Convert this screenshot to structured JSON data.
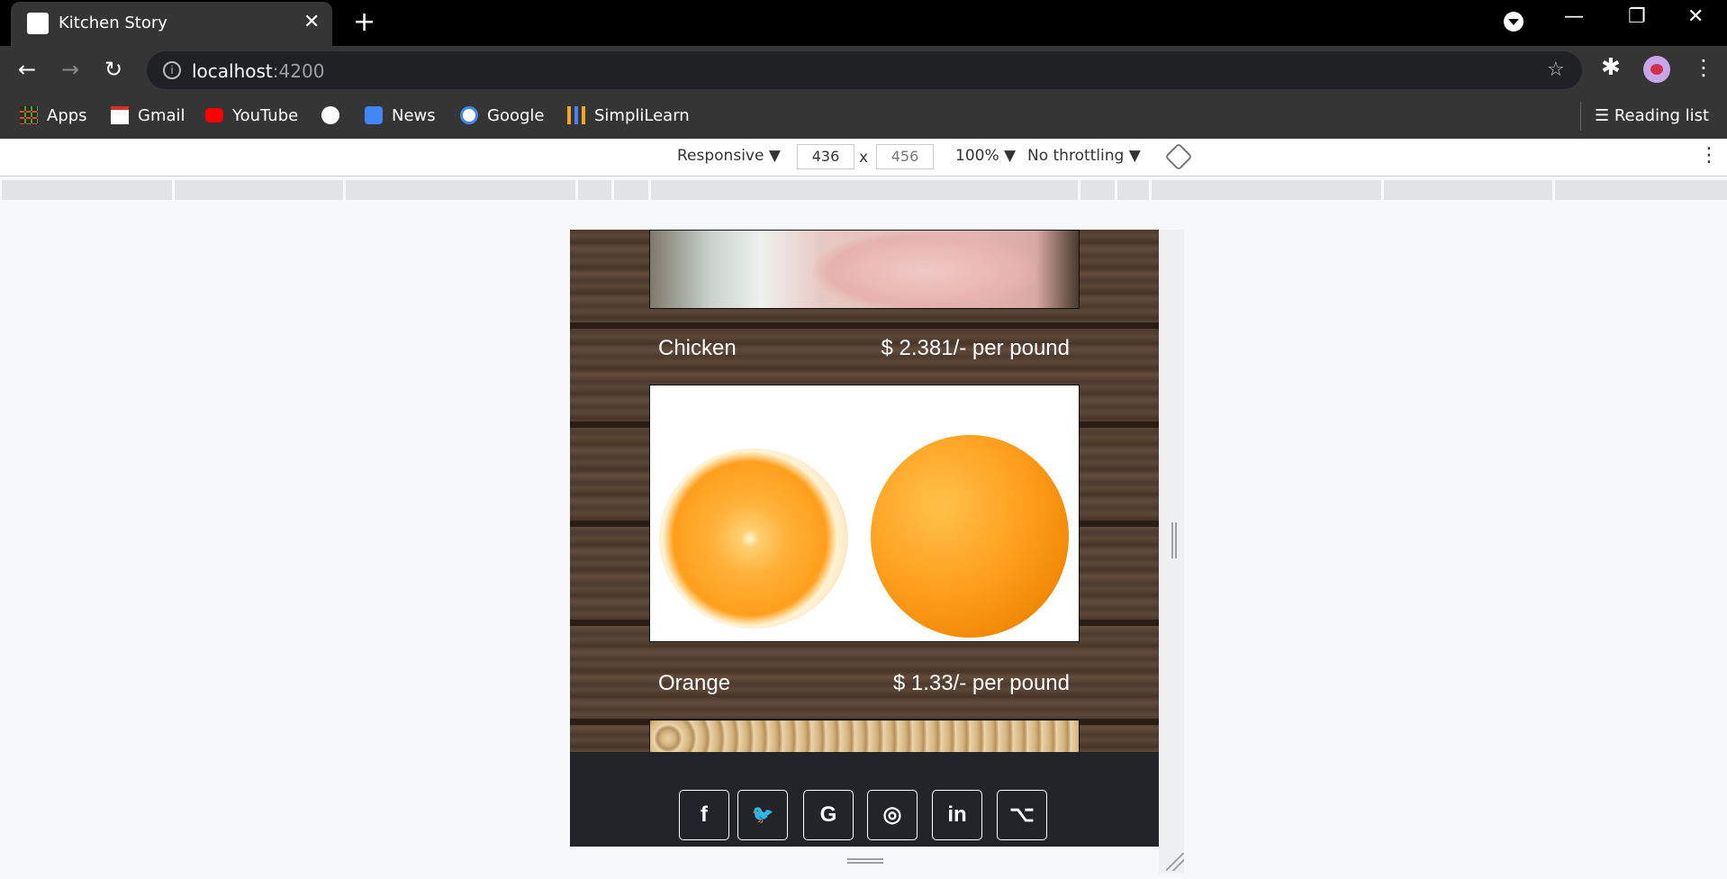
{
  "tab": {
    "title": "Kitchen Story",
    "close": "✕",
    "new_tab": "+"
  },
  "window": {
    "minimize": "—",
    "restore": "❐",
    "close": "✕"
  },
  "toolbar": {
    "back": "←",
    "forward": "→",
    "reload": "↻",
    "url_host": "localhost",
    "url_port": ":4200",
    "star": "☆",
    "menu": "⋮"
  },
  "bookmarks": [
    {
      "label": "Apps",
      "icon": "apps-grid-icon",
      "color": "#ea4335"
    },
    {
      "label": "Gmail",
      "icon": "gmail-icon",
      "color": "#d93025"
    },
    {
      "label": "YouTube",
      "icon": "youtube-icon",
      "color": "#ff0000"
    },
    {
      "label": "",
      "icon": "globe-icon",
      "color": "#ffffff"
    },
    {
      "label": "News",
      "icon": "news-icon",
      "color": "#4285f4"
    },
    {
      "label": "Google",
      "icon": "google-icon",
      "color": "#4285f4"
    },
    {
      "label": "SimpliLearn",
      "icon": "simplilearn-icon",
      "color": "#f5a623"
    }
  ],
  "reading_list": "Reading list",
  "devtools": {
    "device": "Responsive ▼",
    "width": "436",
    "times": "x",
    "height": "456",
    "zoom": "100% ▼",
    "throttling": "No throttling ▼",
    "more": "⋮"
  },
  "products": [
    {
      "name": "Chicken",
      "price": "$ 2.381/- per pound"
    },
    {
      "name": "Orange",
      "price": "$ 1.33/- per pound"
    }
  ],
  "social": [
    {
      "label": "f",
      "icon": "facebook-icon"
    },
    {
      "label": "🐦",
      "icon": "twitter-icon"
    },
    {
      "label": "G",
      "icon": "google-icon"
    },
    {
      "label": "◎",
      "icon": "instagram-icon"
    },
    {
      "label": "in",
      "icon": "linkedin-icon"
    },
    {
      "label": "⌥",
      "icon": "github-icon"
    }
  ]
}
